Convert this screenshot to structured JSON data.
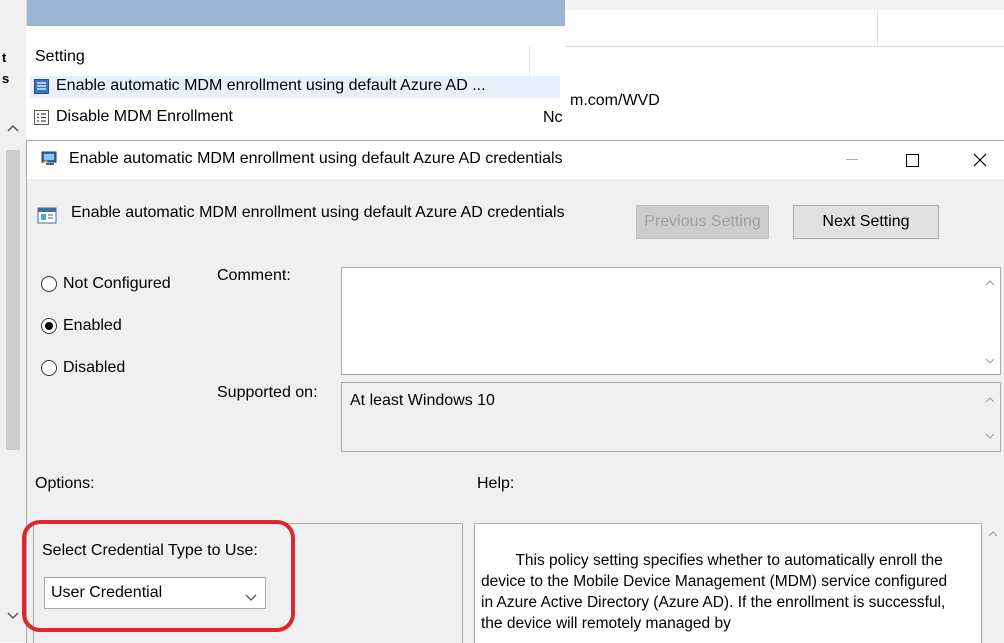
{
  "background_window": {
    "truncated_left_labels": [
      "t",
      "s"
    ],
    "list_header": "Setting",
    "rows": [
      {
        "label": "Enable automatic MDM enrollment using default Azure AD ...",
        "icon": "policy-setting-icon",
        "selected": true
      },
      {
        "label": "Disable MDM Enrollment",
        "icon": "policy-list-icon",
        "selected": false
      }
    ],
    "right_pane_text": "m.com/WVD",
    "right_pane_partial": "Nc"
  },
  "dialog": {
    "title": "Enable automatic MDM enrollment using default Azure AD credentials",
    "policy_name": "Enable automatic MDM enrollment using default Azure AD credentials",
    "previous_button": "Previous Setting",
    "next_button": "Next Setting",
    "radio_options": [
      {
        "label": "Not Configured",
        "selected": false
      },
      {
        "label": "Enabled",
        "selected": true
      },
      {
        "label": "Disabled",
        "selected": false
      }
    ],
    "comment_label": "Comment:",
    "comment_value": "",
    "supported_label": "Supported on:",
    "supported_value": "At least Windows 10",
    "options_label": "Options:",
    "help_label": "Help:",
    "credential_type_label": "Select Credential Type to Use:",
    "credential_type_value": "User Credential",
    "help_text": "        This policy setting specifies whether to automatically enroll the device to the Mobile Device Management (MDM) service configured in Azure Active Directory (Azure AD). If the enrollment is successful, the device will remotely managed by"
  },
  "colors": {
    "highlight": "#e0252f",
    "dialog_body": "#f0f0f0",
    "selected_row": "#e8f1fb",
    "bg_titlebar": "#9bb5d3"
  }
}
